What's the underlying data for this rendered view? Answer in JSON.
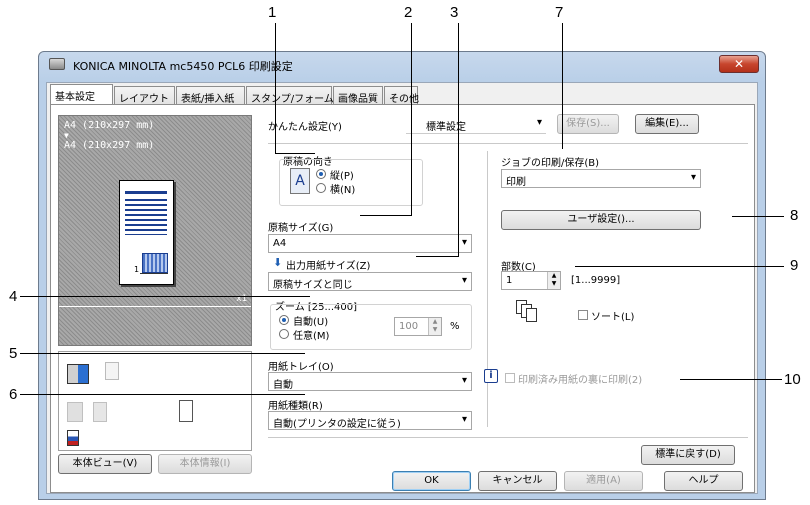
{
  "callouts": [
    "1",
    "2",
    "3",
    "4",
    "5",
    "6",
    "7",
    "8",
    "9",
    "10"
  ],
  "window": {
    "title": "KONICA MINOLTA mc5450 PCL6 印刷設定",
    "close": "✕"
  },
  "tabs": [
    "基本設定",
    "レイアウト",
    "表紙/挿入紙",
    "スタンプ/フォーム",
    "画像品質",
    "その他"
  ],
  "preview": {
    "line1": "A4 (210x297 mm)",
    "arrow": "▼",
    "line2": "A4 (210x297 mm)",
    "copies": "x1",
    "page_num": "1"
  },
  "left_buttons": {
    "view": "本体ビュー(V)",
    "info": "本体情報(I)"
  },
  "easy": {
    "label": "かんたん設定(Y)",
    "value": "標準設定",
    "save": "保存(S)...",
    "edit": "編集(E)..."
  },
  "orientation": {
    "label": "原稿の向き",
    "portrait": "縦(P)",
    "landscape": "横(N)",
    "icon": "A"
  },
  "original_size": {
    "label": "原稿サイズ(G)",
    "value": "A4"
  },
  "output_size": {
    "label": "出力用紙サイズ(Z)",
    "value": "原稿サイズと同じ"
  },
  "zoom": {
    "label": "ズーム [25...400]",
    "auto": "自動(U)",
    "manual": "任意(M)",
    "value": "100",
    "unit": "%"
  },
  "tray": {
    "label": "用紙トレイ(O)",
    "value": "自動"
  },
  "paper_type": {
    "label": "用紙種類(R)",
    "value": "自動(プリンタの設定に従う)"
  },
  "job": {
    "label": "ジョブの印刷/保存(B)",
    "value": "印刷"
  },
  "user_settings": "ユーザ設定()...",
  "copies": {
    "label": "部数(C)",
    "value": "1",
    "range": "[1...9999]",
    "sort": "ソート(L)"
  },
  "printed_back": "印刷済み用紙の裏に印刷(2)",
  "info_icon": "i",
  "defaults": "標準に戻す(D)",
  "footer": {
    "ok": "OK",
    "cancel": "キャンセル",
    "apply": "適用(A)",
    "help": "ヘルプ"
  }
}
